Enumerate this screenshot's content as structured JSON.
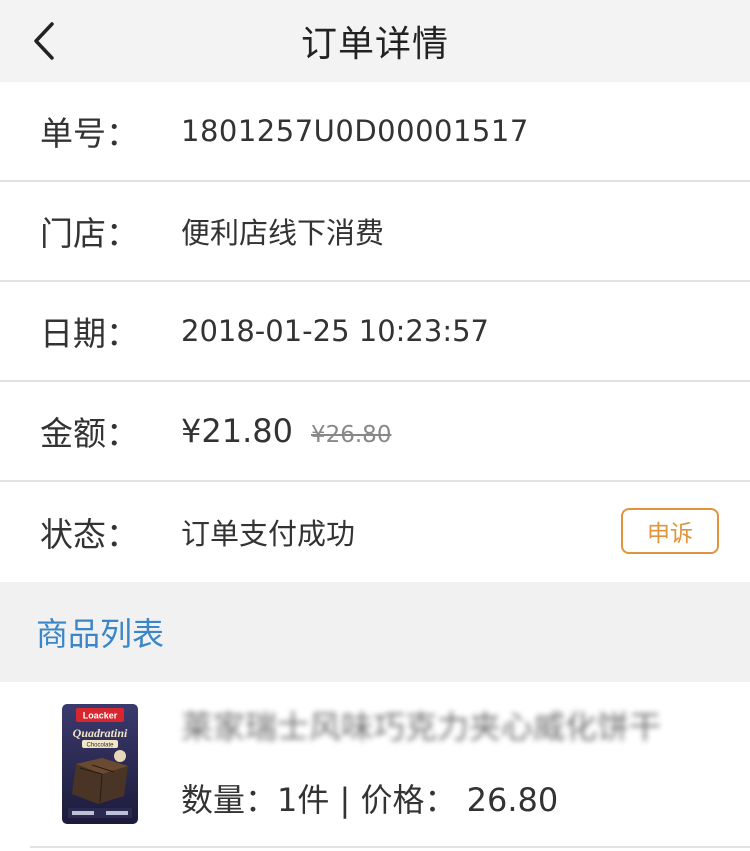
{
  "header": {
    "title": "订单详情"
  },
  "order": {
    "number_label": "单号：",
    "number": "1801257U0D00001517",
    "store_label": "门店：",
    "store": "便利店线下消费",
    "date_label": "日期：",
    "date": "2018-01-25 10:23:57",
    "amount_label": "金额：",
    "amount": "¥21.80",
    "original_amount": "¥26.80",
    "status_label": "状态：",
    "status": "订单支付成功",
    "complain_label": "申诉"
  },
  "products": {
    "section_title": "商品列表",
    "items": [
      {
        "name": "莱家瑞士风味巧克力夹心威化饼干",
        "meta": "数量：1件 | 价格： 26.80",
        "thumb_brand": "Loacker",
        "thumb_product": "Quadratini",
        "thumb_flavor": "Chocolate"
      }
    ]
  },
  "colors": {
    "accent_blue": "#3a86c8",
    "complain_orange": "#e0953d",
    "nav_bg": "#f3f3f3"
  },
  "icons": {
    "back": "chevron-left-icon"
  }
}
